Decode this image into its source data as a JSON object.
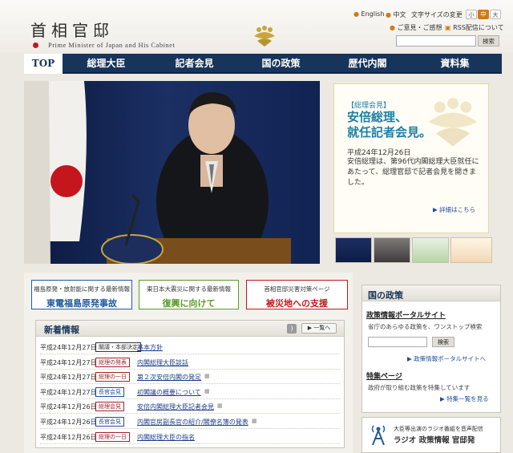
{
  "header": {
    "title": "首相官邸",
    "subtitle": "Prime Minister of Japan and His Cabinet",
    "lang_english": "English",
    "lang_chinese": "中文",
    "font_size_label": "文字サイズの変更",
    "font_sizes": [
      "小",
      "中",
      "大"
    ],
    "opinion_link": "ご意見・ご感想",
    "rss_link": "RSS配信について",
    "search_button": "検索"
  },
  "nav": {
    "items": [
      "TOP",
      "総理大臣",
      "記者会見",
      "国の政策",
      "歴代内閣",
      "資料集"
    ]
  },
  "feature": {
    "label": "【総理会見】",
    "title_line1": "安倍総理、",
    "title_line2": "就任記者会見。",
    "date": "平成24年12月26日",
    "text": "安倍総理は、第96代内閣総理大臣就任にあたって、総理官邸で記者会見を開きました。",
    "link": "▶ 詳細はこちら"
  },
  "info_boxes": [
    {
      "sub": "福島原発・放射能に関する最新情報",
      "main": "東電福島原発事故",
      "color": "#1f5b9c"
    },
    {
      "sub": "東日本大震災に関する最新情報",
      "main": "復興に向けて",
      "color": "#5b9a2a"
    },
    {
      "sub": "首相官邸災害対策ページ",
      "main": "被災地への支援",
      "color": "#c5161d"
    }
  ],
  "news": {
    "title": "新着情報",
    "more": "▶ 一覧へ",
    "rows": [
      {
        "date": "平成24年12月27日",
        "badge": "閣議・本部決定",
        "badge_color": "#333333",
        "link": "基本方針",
        "media": ""
      },
      {
        "date": "平成24年12月27日",
        "badge": "総理の発表",
        "badge_color": "#a0252b",
        "link": "内閣総理大臣談話",
        "media": ""
      },
      {
        "date": "平成24年12月27日",
        "badge": "総理の一日",
        "badge_color": "#a0252b",
        "link": "第２次安倍内閣の発足",
        "media": "▦"
      },
      {
        "date": "平成24年12月27日",
        "badge": "長官会見",
        "badge_color": "#1f4d9a",
        "link": "初閣議の概要について",
        "media": "▦"
      },
      {
        "date": "平成24年12月26日",
        "badge": "総理会見",
        "badge_color": "#a0252b",
        "link": "安倍内閣総理大臣記者会見",
        "media": "▦"
      },
      {
        "date": "平成24年12月26日",
        "badge": "長官会見",
        "badge_color": "#1f4d9a",
        "link": "内閣官房副長官の紹介/閣僚名簿の発表",
        "media": "▦"
      },
      {
        "date": "平成24年12月26日",
        "badge": "総理の一日",
        "badge_color": "#a0252b",
        "link": "内閣総理大臣の指名",
        "media": ""
      }
    ]
  },
  "sidebar": {
    "title": "国の政策",
    "portal_title": "政策情報ポータルサイト",
    "portal_desc": "省庁のあらゆる政策を、ワンストップ検索",
    "search_button": "検索",
    "portal_link": "▶ 政策情報ポータルサイトへ",
    "special_title": "特集ページ",
    "special_desc": "政府が取り組む政策を特集しています",
    "special_link": "▶ 特集一覧を見る"
  },
  "radio": {
    "line1": "大臣等出演のラジオ番組を音声配信",
    "line2": "ラジオ 政策情報 官邸発"
  }
}
